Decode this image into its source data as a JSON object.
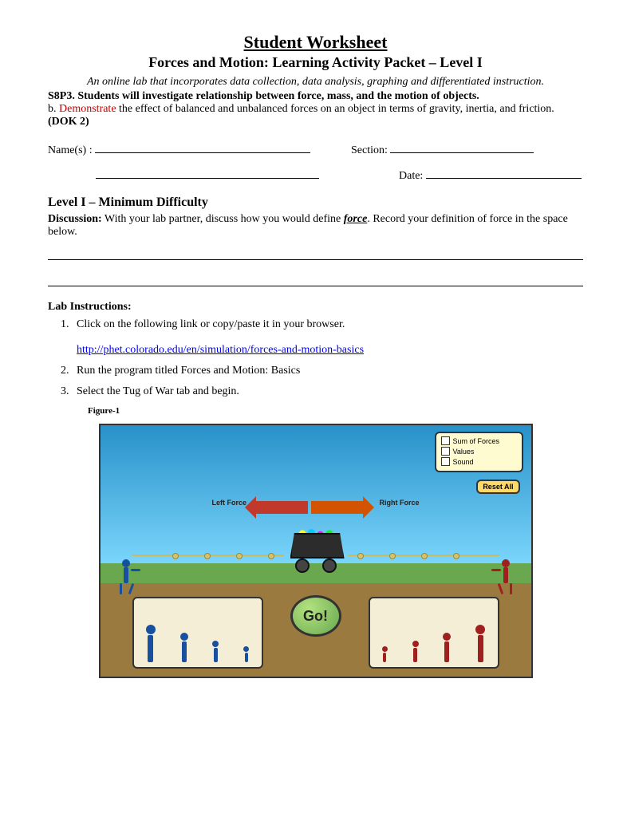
{
  "header": {
    "title": "Student Worksheet",
    "subtitle": "Forces and Motion:  Learning Activity Packet – Level I",
    "tagline": "An online lab that incorporates data collection, data analysis, graphing and differentiated instruction."
  },
  "standard": {
    "code": "S8P3. Students will investigate relationship between force, mass, and the motion of objects.",
    "sub_prefix": "b. ",
    "sub_highlight": "Demonstrate",
    "sub_rest": " the effect of balanced and unbalanced forces on an object in terms of gravity, inertia, and friction. ",
    "dok": "(DOK 2)"
  },
  "fields": {
    "names_label": "Name(s) :",
    "section_label": "Section:",
    "date_label": "Date:"
  },
  "level": {
    "heading": "Level I – Minimum Difficulty",
    "discussion_label": "Discussion:",
    "discussion_text_pre": "  With your lab partner, discuss how you would define ",
    "discussion_term": "force",
    "discussion_text_post": ".  Record your definition of force in the space below."
  },
  "lab": {
    "heading": "Lab Instructions:",
    "items": [
      "Click on the following link or copy/paste it in your browser.",
      "Run the program titled Forces and Motion:  Basics",
      "Select the Tug of War tab and begin."
    ],
    "link_url": "http://phet.colorado.edu/en/simulation/forces-and-motion-basics",
    "figure_label": "Figure-1"
  },
  "sim": {
    "control_options": [
      "Sum of Forces",
      "Values",
      "Sound"
    ],
    "reset_label": "Reset All",
    "left_force": "Left Force",
    "right_force": "Right Force",
    "go_label": "Go!"
  }
}
